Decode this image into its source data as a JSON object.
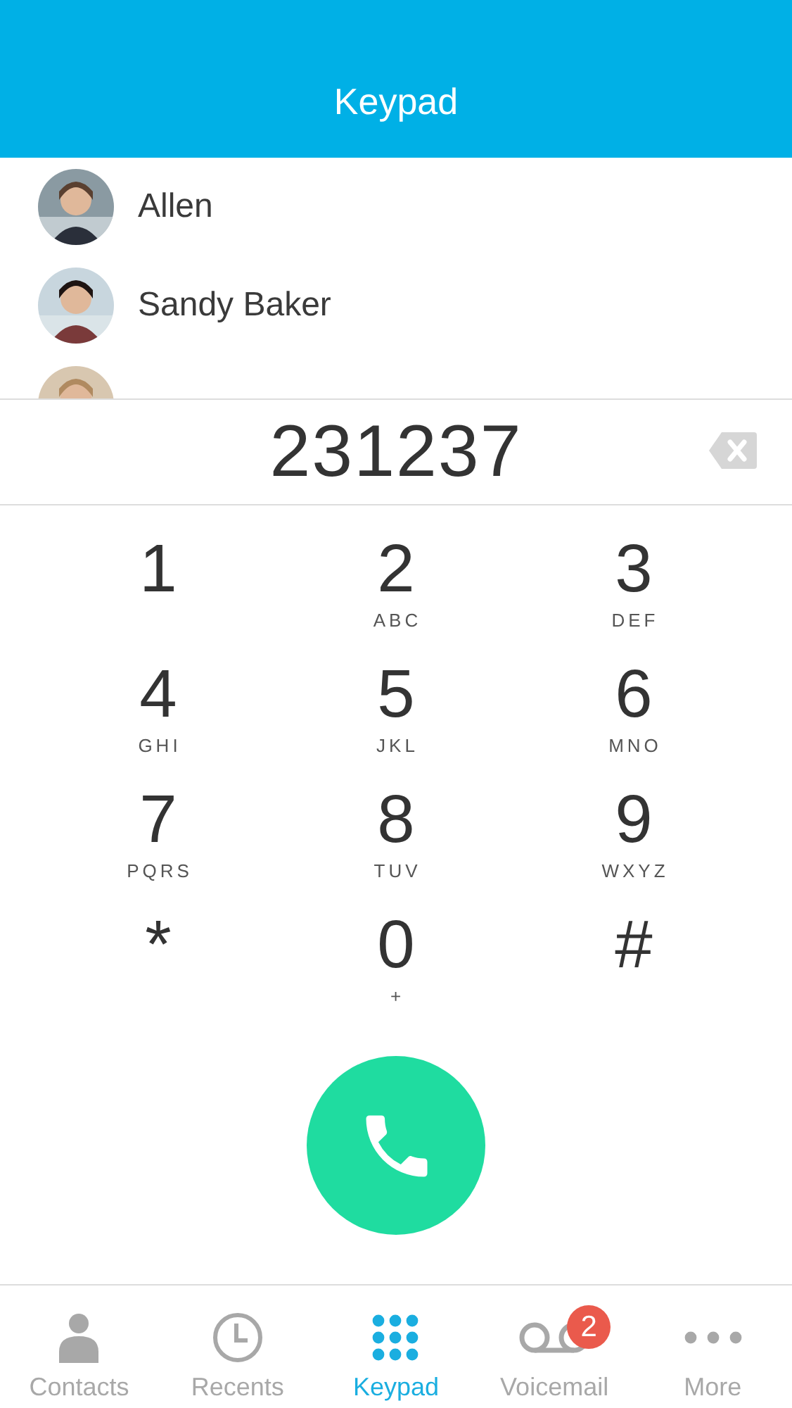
{
  "header": {
    "title": "Keypad"
  },
  "contacts": [
    {
      "kind": "contact",
      "name": "Allen"
    },
    {
      "kind": "contact",
      "name": "Sandy Baker"
    },
    {
      "kind": "picture"
    }
  ],
  "display": {
    "number": "231237"
  },
  "keys": [
    {
      "digit": "1"
    },
    {
      "digit": "2",
      "letters": "ABC"
    },
    {
      "digit": "3",
      "letters": "DEF"
    },
    {
      "digit": "4",
      "letters": "GHI"
    },
    {
      "digit": "5",
      "letters": "JKL"
    },
    {
      "digit": "6",
      "letters": "MNO"
    },
    {
      "digit": "7",
      "letters": "PQRS"
    },
    {
      "digit": "8",
      "letters": "TUV"
    },
    {
      "digit": "9",
      "letters": "WXYZ"
    },
    {
      "digit": "*"
    },
    {
      "digit": "0",
      "letters": "+"
    },
    {
      "digit": "#"
    }
  ],
  "tabs": [
    {
      "kind": "contacts",
      "label": "Contacts",
      "selected": false
    },
    {
      "kind": "recents",
      "label": "Recents",
      "selected": false
    },
    {
      "kind": "keypad",
      "label": "Keypad",
      "selected": true
    },
    {
      "kind": "voicemail",
      "label": "Voicemail",
      "selected": false,
      "badge": "2"
    },
    {
      "kind": "more",
      "label": "More",
      "selected": false
    }
  ]
}
